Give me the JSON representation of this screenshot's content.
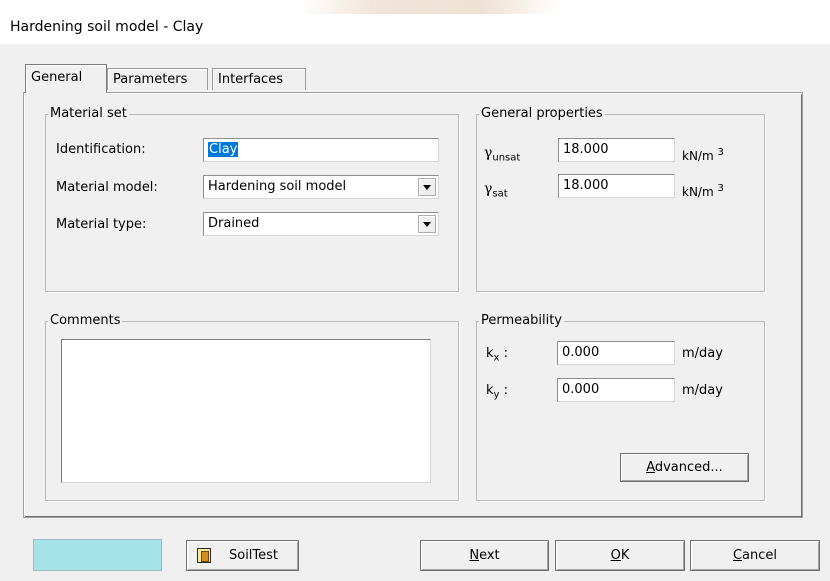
{
  "window": {
    "title": "Hardening soil model - Clay"
  },
  "tabs": [
    {
      "label": "General",
      "active": true
    },
    {
      "label": "Parameters",
      "active": false
    },
    {
      "label": "Interfaces",
      "active": false
    }
  ],
  "material_set": {
    "legend": "Material set",
    "identification_label": "Identification:",
    "identification_value": "Clay",
    "model_label": "Material model:",
    "model_value": "Hardening soil model",
    "type_label": "Material type:",
    "type_value": "Drained"
  },
  "general_properties": {
    "legend": "General properties",
    "gamma_symbol": "γ",
    "unsat_sub": "unsat",
    "sat_sub": "sat",
    "gamma_unsat_value": "18.000",
    "gamma_sat_value": "18.000",
    "unit_base": "kN/m",
    "unit_exp": "3"
  },
  "comments": {
    "legend": "Comments",
    "text": ""
  },
  "permeability": {
    "legend": "Permeability",
    "k_symbol": "k",
    "kx_sub": "x",
    "ky_sub": "y",
    "colon": " :",
    "kx_value": "0.000",
    "ky_value": "0.000",
    "unit": "m/day",
    "advanced_hot": "A",
    "advanced_rest": "dvanced..."
  },
  "buttons": {
    "color_swatch": "#a6e3e9",
    "soiltest_label": "SoilTest",
    "next_hot": "N",
    "next_rest": "ext",
    "ok_hot": "O",
    "ok_rest": "K",
    "cancel_hot": "C",
    "cancel_rest": "ancel"
  },
  "icons": {
    "dropdown": "chevron-down-icon",
    "soiltest": "soiltest-icon"
  }
}
